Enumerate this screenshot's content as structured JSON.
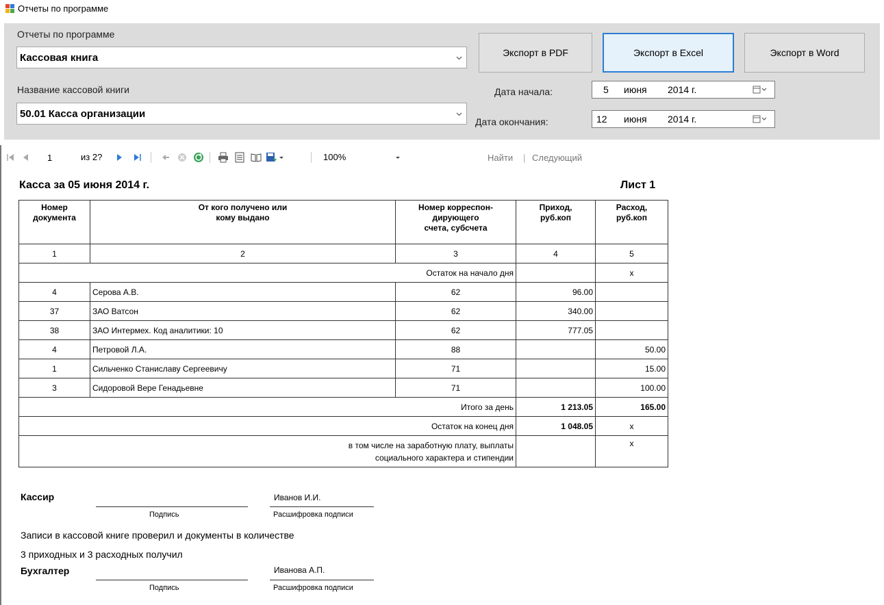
{
  "window": {
    "title": "Отчеты по программе"
  },
  "form": {
    "report_label": "Отчеты по программе",
    "report_value": "Кассовая книга",
    "book_label": "Название кассовой книги",
    "book_value": "50.01 Касса организации",
    "btn_pdf": "Экспорт в PDF",
    "btn_excel": "Экспорт в Excel",
    "btn_word": "Экспорт в Word",
    "start_label": "Дата начала:",
    "end_label": "Дата окончания:",
    "start_day": "5",
    "start_month": "июня",
    "start_year": "2014 г.",
    "end_day": "12",
    "end_month": "июня",
    "end_year": "2014 г."
  },
  "toolbar": {
    "page": "1",
    "of_pages": "из 2?",
    "zoom": "100%",
    "find": "Найти",
    "separator": "|",
    "next": "Следующий"
  },
  "report": {
    "title": "Касса за 05 июня 2014 г.",
    "sheet": "Лист 1",
    "headers": {
      "doc_l1": "Номер",
      "doc_l2": "документа",
      "from_l1": "От кого получено или",
      "from_l2": "кому выдано",
      "acc_l1": "Номер корреспон-",
      "acc_l2": "дирующего",
      "acc_l3": "счета, субсчета",
      "in_l1": "Приход,",
      "in_l2": "руб.коп",
      "out_l1": "Расход,",
      "out_l2": "руб.коп"
    },
    "numbers": [
      "1",
      "2",
      "3",
      "4",
      "5"
    ],
    "opening": {
      "label": "Остаток на начало дня",
      "out": "х"
    },
    "rows": [
      {
        "doc": "4",
        "who": "Серова А.В.",
        "acc": "62",
        "in": "96.00",
        "out": ""
      },
      {
        "doc": "37",
        "who": "ЗАО Ватсон",
        "acc": "62",
        "in": "340.00",
        "out": ""
      },
      {
        "doc": "38",
        "who": "ЗАО Интермех. Код аналитики: 10",
        "acc": "62",
        "in": "777.05",
        "out": ""
      },
      {
        "doc": "4",
        "who": "Петровой Л.А.",
        "acc": "88",
        "in": "",
        "out": "50.00"
      },
      {
        "doc": "1",
        "who": "Сильченко Станиславу Сергеевичу",
        "acc": "71",
        "in": "",
        "out": "15.00"
      },
      {
        "doc": "3",
        "who": "Сидоровой Вере Генадьевне",
        "acc": "71",
        "in": "",
        "out": "100.00"
      }
    ],
    "total": {
      "label": "Итого за день",
      "in": "1 213.05",
      "out": "165.00"
    },
    "closing": {
      "label": "Остаток на конец дня",
      "in": "1 048.05",
      "out": "х"
    },
    "salary": {
      "line1": "в том числе на заработную плату, выплаты",
      "line2": "социального характера и стипендии",
      "out": "х"
    },
    "cashier": {
      "label": "Кассир",
      "name": "Иванов И.И.",
      "sign": "Подпись",
      "decode": "Расшифровка подписи"
    },
    "note1": "Записи в кассовой книге проверил и документы в количестве",
    "note2": "3 приходных и 3 расходных получил",
    "accountant": {
      "label": "Бухгалтер",
      "name": "Иванова А.П.",
      "sign": "Подпись",
      "decode": "Расшифровка подписи"
    }
  }
}
